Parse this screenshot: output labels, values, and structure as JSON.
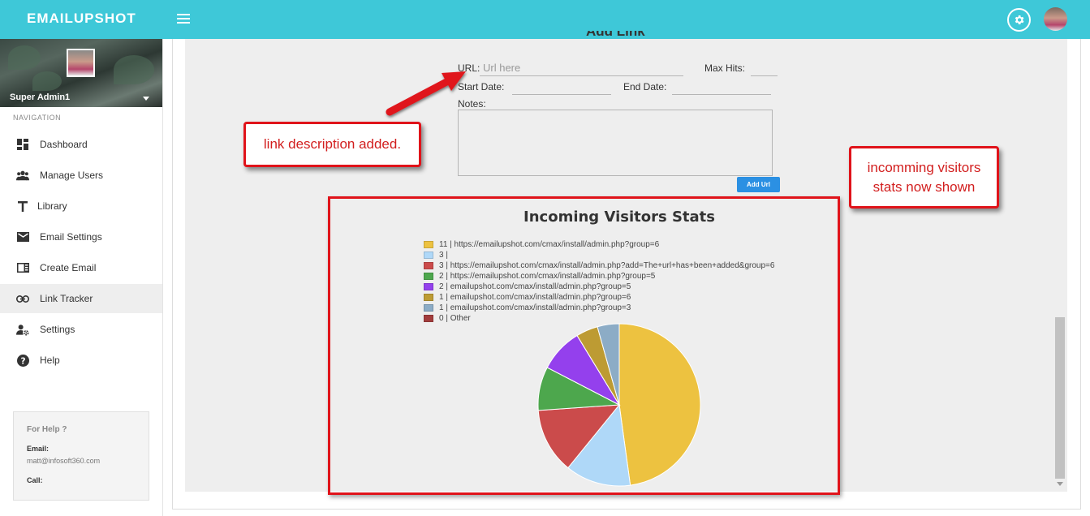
{
  "app": {
    "brand": "EMAILUPSHOT"
  },
  "topbar": {
    "menu_icon": "hamburger-menu-icon",
    "settings_icon": "gear-icon",
    "avatar_icon": "user-avatar"
  },
  "sidebar": {
    "user_name": "Super Admin1",
    "nav_heading": "NAVIGATION",
    "items": [
      {
        "label": "Dashboard",
        "icon": "dashboard-icon",
        "active": false
      },
      {
        "label": "Manage Users",
        "icon": "users-icon",
        "active": false
      },
      {
        "label": "Library",
        "icon": "text-icon",
        "active": false
      },
      {
        "label": "Email Settings",
        "icon": "envelope-icon",
        "active": false
      },
      {
        "label": "Create Email",
        "icon": "compose-icon",
        "active": false
      },
      {
        "label": "Link Tracker",
        "icon": "link-icon",
        "active": true
      },
      {
        "label": "Settings",
        "icon": "user-settings-icon",
        "active": false
      },
      {
        "label": "Help",
        "icon": "help-icon",
        "active": false
      }
    ],
    "help_box": {
      "title": "For Help ?",
      "email_label": "Email:",
      "email_value": "matt@infosoft360.com",
      "call_label": "Call:"
    }
  },
  "form": {
    "title": "Add Link",
    "url_label": "URL:",
    "url_placeholder": "Url here",
    "url_value": "",
    "max_hits_label": "Max Hits:",
    "max_hits_value": "",
    "start_date_label": "Start Date:",
    "start_date_value": "",
    "end_date_label": "End Date:",
    "end_date_value": "",
    "notes_label": "Notes:",
    "notes_value": "",
    "add_button": "Add Url"
  },
  "annotations": {
    "link_description": "link description added.",
    "visitors_stats_line1": "incomming visitors",
    "visitors_stats_line2": "stats now shown",
    "highlight_color": "#e0131a"
  },
  "chart_data": {
    "type": "pie",
    "title": "Incoming Visitors Stats",
    "legend_position": "top-left",
    "labels": [
      "https://emailupshot.com/cmax/install/admin.php?group=6",
      "",
      "https://emailupshot.com/cmax/install/admin.php?add=The+url+has+been+added&group=6",
      "https://emailupshot.com/cmax/install/admin.php?group=5",
      "emailupshot.com/cmax/install/admin.php?group=5",
      "emailupshot.com/cmax/install/admin.php?group=6",
      "emailupshot.com/cmax/install/admin.php?group=3",
      "Other"
    ],
    "values": [
      11,
      3,
      3,
      2,
      2,
      1,
      1,
      0
    ],
    "legend_text": [
      "11 | https://emailupshot.com/cmax/install/admin.php?group=6",
      "3 |",
      "3 | https://emailupshot.com/cmax/install/admin.php?add=The+url+has+been+added&group=6",
      "2 | https://emailupshot.com/cmax/install/admin.php?group=5",
      "2 | emailupshot.com/cmax/install/admin.php?group=5",
      "1 | emailupshot.com/cmax/install/admin.php?group=6",
      "1 | emailupshot.com/cmax/install/admin.php?group=3",
      "0 | Other"
    ],
    "colors": [
      "#edc240",
      "#afd8f8",
      "#cb4b4b",
      "#4da74d",
      "#9440ed",
      "#bd9b33",
      "#8cacc6",
      "#a23c3c"
    ]
  }
}
